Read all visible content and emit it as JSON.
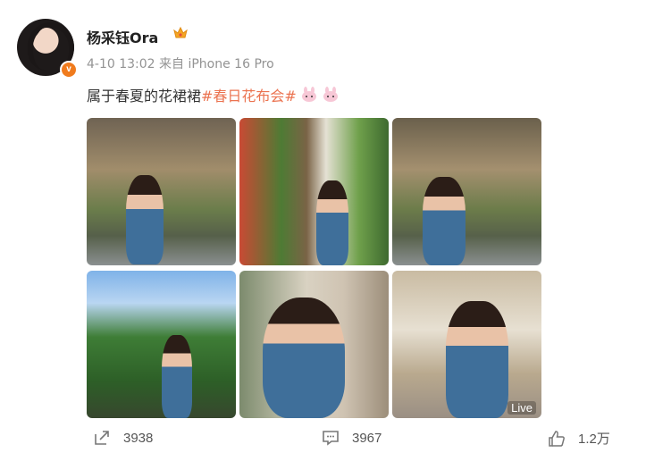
{
  "post": {
    "username": "杨采钰Ora",
    "meta": "4-10 13:02  来自 iPhone 16 Pro",
    "text": "属于春夏的花裙裙",
    "hashtag": "#春日花布会#",
    "live_label": "Live"
  },
  "actions": {
    "share_count": "3938",
    "comment_count": "3967",
    "like_count": "1.2万"
  },
  "colors": {
    "hashtag": "#eb7350",
    "verified_badge": "#f07b1d"
  }
}
